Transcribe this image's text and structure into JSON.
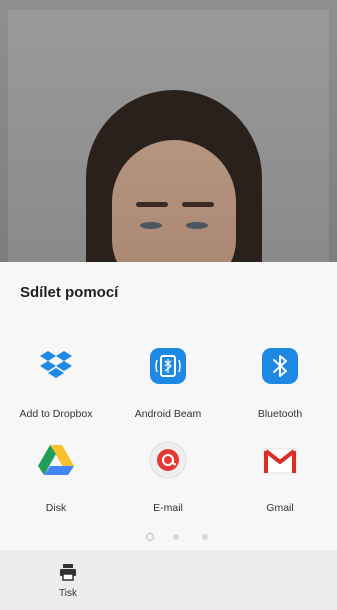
{
  "share_sheet": {
    "title": "Sdílet pomocí",
    "apps": [
      {
        "label": "Add to Dropbox",
        "icon": "dropbox-icon"
      },
      {
        "label": "Android Beam",
        "icon": "android-beam-icon"
      },
      {
        "label": "Bluetooth",
        "icon": "bluetooth-icon"
      },
      {
        "label": "Disk",
        "icon": "google-drive-icon"
      },
      {
        "label": "E-mail",
        "icon": "email-icon"
      },
      {
        "label": "Gmail",
        "icon": "gmail-icon"
      }
    ],
    "pages": 3,
    "current_page": 1
  },
  "bottom_bar": {
    "print_label": "Tisk",
    "print_icon": "printer-icon"
  },
  "colors": {
    "dropbox": "#1e88e5",
    "android_beam": "#1e88e5",
    "bluetooth": "#1e88e5",
    "gmail_red": "#d93025",
    "email_red": "#e53935",
    "sheet_bg": "#f7f7f7",
    "bottom_bar_bg": "#ececec"
  }
}
